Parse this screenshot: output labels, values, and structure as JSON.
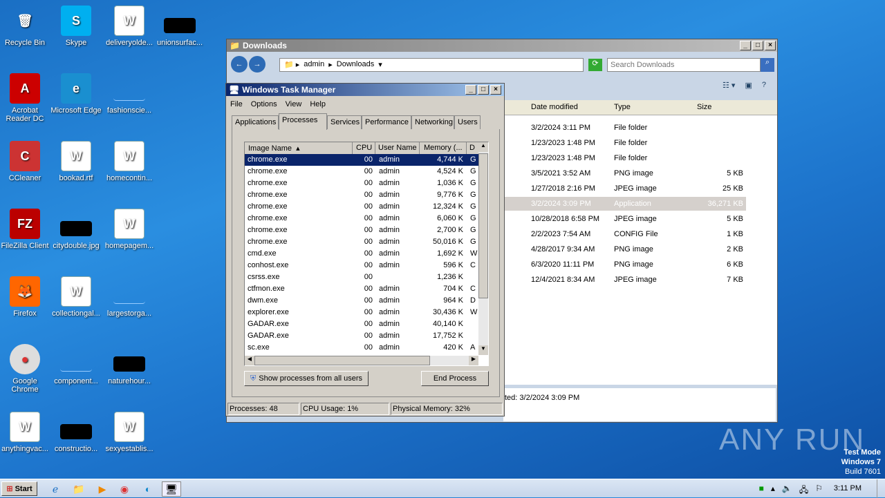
{
  "desktop": {
    "icons": [
      {
        "label": "Recycle Bin",
        "glyph": "🗑",
        "type": "bin"
      },
      {
        "label": "Skype",
        "glyph": "S",
        "type": "skype"
      },
      {
        "label": "deliveryolde...",
        "glyph": "W",
        "type": "word"
      },
      {
        "label": "unionsurfac...",
        "glyph": "",
        "type": "black"
      },
      {
        "label": "Acrobat Reader DC",
        "glyph": "A",
        "type": "acrobat"
      },
      {
        "label": "Microsoft Edge",
        "glyph": "e",
        "type": "edge"
      },
      {
        "label": "fashionscie...",
        "glyph": "",
        "type": "blank"
      },
      {
        "label": "CCleaner",
        "glyph": "C",
        "type": "ccleaner"
      },
      {
        "label": "bookad.rtf",
        "glyph": "W",
        "type": "word"
      },
      {
        "label": "homecontin...",
        "glyph": "W",
        "type": "word"
      },
      {
        "label": "FileZilla Client",
        "glyph": "FZ",
        "type": "filezilla"
      },
      {
        "label": "citydouble.jpg",
        "glyph": "",
        "type": "black"
      },
      {
        "label": "homepagem...",
        "glyph": "W",
        "type": "word"
      },
      {
        "label": "Firefox",
        "glyph": "🦊",
        "type": "firefox"
      },
      {
        "label": "collectiongal...",
        "glyph": "W",
        "type": "word"
      },
      {
        "label": "largestorga...",
        "glyph": "",
        "type": "blank"
      },
      {
        "label": "Google Chrome",
        "glyph": "●",
        "type": "chrome"
      },
      {
        "label": "component...",
        "glyph": "",
        "type": "blank"
      },
      {
        "label": "naturehour...",
        "glyph": "",
        "type": "black"
      },
      {
        "label": "anythingvac...",
        "glyph": "W",
        "type": "word"
      },
      {
        "label": "constructio...",
        "glyph": "",
        "type": "black"
      },
      {
        "label": "sexyestablis...",
        "glyph": "W",
        "type": "word"
      }
    ]
  },
  "explorer": {
    "title": "Downloads",
    "breadcrumb": [
      "admin",
      "Downloads"
    ],
    "search_placeholder": "Search Downloads",
    "columns": [
      "Date modified",
      "Type",
      "Size"
    ],
    "rows": [
      {
        "date": "3/2/2024 3:11 PM",
        "type": "File folder",
        "size": ""
      },
      {
        "date": "1/23/2023 1:48 PM",
        "type": "File folder",
        "size": ""
      },
      {
        "date": "1/23/2023 1:48 PM",
        "type": "File folder",
        "size": ""
      },
      {
        "date": "3/5/2021 3:52 AM",
        "type": "PNG image",
        "size": "5 KB"
      },
      {
        "date": "1/27/2018 2:16 PM",
        "type": "JPEG image",
        "size": "25 KB"
      },
      {
        "date": "3/2/2024 3:09 PM",
        "type": "Application",
        "size": "36,271 KB",
        "selected": true
      },
      {
        "date": "10/28/2018 6:58 PM",
        "type": "JPEG image",
        "size": "5 KB"
      },
      {
        "date": "2/2/2023 7:54 AM",
        "type": "CONFIG File",
        "size": "1 KB"
      },
      {
        "date": "4/28/2017 9:34 AM",
        "type": "PNG image",
        "size": "2 KB"
      },
      {
        "date": "6/3/2020 11:11 PM",
        "type": "PNG image",
        "size": "6 KB"
      },
      {
        "date": "12/4/2021 8:34 AM",
        "type": "JPEG image",
        "size": "7 KB"
      }
    ],
    "details": "ted: 3/2/2024 3:09 PM"
  },
  "taskmgr": {
    "title": "Windows Task Manager",
    "menu": [
      "File",
      "Options",
      "View",
      "Help"
    ],
    "tabs": [
      "Applications",
      "Processes",
      "Services",
      "Performance",
      "Networking",
      "Users"
    ],
    "columns": [
      "Image Name",
      "CPU",
      "User Name",
      "Memory (...",
      "D"
    ],
    "processes": [
      [
        "chrome.exe",
        "00",
        "admin",
        "4,744 K",
        "G"
      ],
      [
        "chrome.exe",
        "00",
        "admin",
        "4,524 K",
        "G"
      ],
      [
        "chrome.exe",
        "00",
        "admin",
        "1,036 K",
        "G"
      ],
      [
        "chrome.exe",
        "00",
        "admin",
        "9,776 K",
        "G"
      ],
      [
        "chrome.exe",
        "00",
        "admin",
        "12,324 K",
        "G"
      ],
      [
        "chrome.exe",
        "00",
        "admin",
        "6,060 K",
        "G"
      ],
      [
        "chrome.exe",
        "00",
        "admin",
        "2,700 K",
        "G"
      ],
      [
        "chrome.exe",
        "00",
        "admin",
        "50,016 K",
        "G"
      ],
      [
        "cmd.exe",
        "00",
        "admin",
        "1,692 K",
        "W"
      ],
      [
        "conhost.exe",
        "00",
        "admin",
        "596 K",
        "C"
      ],
      [
        "csrss.exe",
        "00",
        "",
        "1,236 K",
        ""
      ],
      [
        "ctfmon.exe",
        "00",
        "admin",
        "704 K",
        "C"
      ],
      [
        "dwm.exe",
        "00",
        "admin",
        "964 K",
        "D"
      ],
      [
        "explorer.exe",
        "00",
        "admin",
        "30,436 K",
        "W"
      ],
      [
        "GADAR.exe",
        "00",
        "admin",
        "40,140 K",
        ""
      ],
      [
        "GADAR.exe",
        "00",
        "admin",
        "17,752 K",
        ""
      ],
      [
        "sc.exe",
        "00",
        "admin",
        "420 K",
        "A"
      ]
    ],
    "show_all_label": "Show processes from all users",
    "end_process_label": "End Process",
    "status": {
      "processes": "Processes: 48",
      "cpu": "CPU Usage: 1%",
      "memory": "Physical Memory: 32%"
    }
  },
  "taskbar": {
    "start": "Start",
    "clock": "3:11 PM"
  },
  "watermark": {
    "brand": "ANY RUN",
    "mode": "Test Mode",
    "os": "Windows 7",
    "build": "Build 7601"
  }
}
